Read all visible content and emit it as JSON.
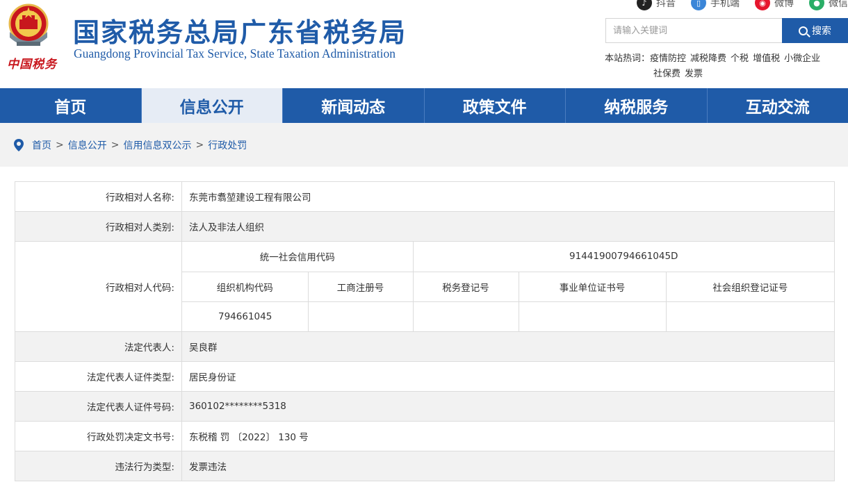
{
  "header": {
    "title": "国家税务总局广东省税务局",
    "subtitle": "Guangdong Provincial Tax Service, State Taxation Administration",
    "logo_text": "中国税务",
    "social": [
      {
        "label": "抖音",
        "icon": "douyin-icon",
        "glyph": "♪"
      },
      {
        "label": "手机端",
        "icon": "mobile-icon",
        "glyph": "▯"
      },
      {
        "label": "微博",
        "icon": "weibo-icon",
        "glyph": "◉"
      },
      {
        "label": "微信",
        "icon": "weixin-icon",
        "glyph": "●"
      }
    ],
    "search": {
      "placeholder": "请输入关键词",
      "button": "搜索"
    },
    "hotwords": {
      "label": "本站热词：",
      "items": [
        "疫情防控",
        "减税降费",
        "个税",
        "增值税",
        "小微企业",
        "社保费",
        "发票"
      ]
    }
  },
  "nav": {
    "items": [
      "首页",
      "信息公开",
      "新闻动态",
      "政策文件",
      "纳税服务",
      "互动交流"
    ],
    "active_index": 1
  },
  "breadcrumb": [
    "首页",
    "信息公开",
    "信用信息双公示",
    "行政处罚"
  ],
  "record": {
    "name_label": "行政相对人名称:",
    "name": "东莞市翥堃建设工程有限公司",
    "category_label": "行政相对人类别:",
    "category": "法人及非法人组织",
    "code_label": "行政相对人代码:",
    "uscc_label": "统一社会信用代码",
    "uscc": "91441900794661045D",
    "code_headers": [
      "组织机构代码",
      "工商注册号",
      "税务登记号",
      "事业单位证书号",
      "社会组织登记证号"
    ],
    "code_values": [
      "794661045",
      "",
      "",
      "",
      ""
    ],
    "rep_label": "法定代表人:",
    "rep": "吴良群",
    "id_type_label": "法定代表人证件类型:",
    "id_type": "居民身份证",
    "id_no_label": "法定代表人证件号码:",
    "id_no": "360102********5318",
    "doc_no_label": "行政处罚决定文书号:",
    "doc_no": "东税稽 罚 〔2022〕 130 号",
    "violation_label": "违法行为类型:",
    "violation": "发票违法"
  },
  "colors": {
    "brand_blue": "#1f5ba8",
    "emblem_red": "#c8161d",
    "shade": "#f2f2f2"
  }
}
